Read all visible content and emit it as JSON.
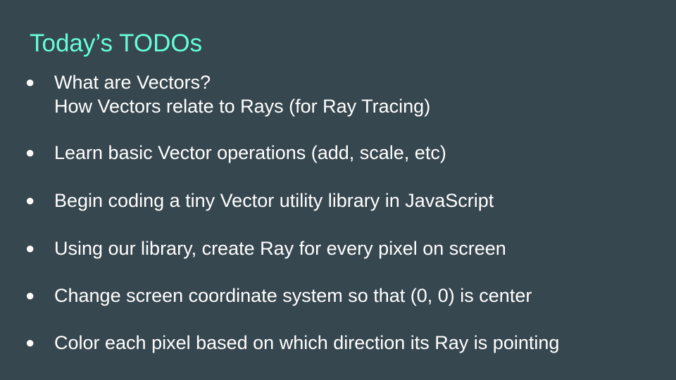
{
  "slide": {
    "title": "Today’s TODOs",
    "bullet_symbol": "●",
    "items": [
      {
        "line1": "What are Vectors?",
        "line2": "How Vectors relate to Rays (for Ray Tracing)"
      },
      {
        "line1": "Learn basic Vector operations (add, scale, etc)"
      },
      {
        "line1": "Begin coding a tiny Vector utility library in JavaScript"
      },
      {
        "line1": "Using our library, create Ray for every pixel on screen"
      },
      {
        "line1": "Change screen coordinate system so that (0, 0) is center"
      },
      {
        "line1": "Color each pixel based on which direction its Ray is pointing"
      }
    ]
  },
  "colors": {
    "background": "#37474f",
    "title": "#64ffda",
    "text": "#ffffff"
  }
}
